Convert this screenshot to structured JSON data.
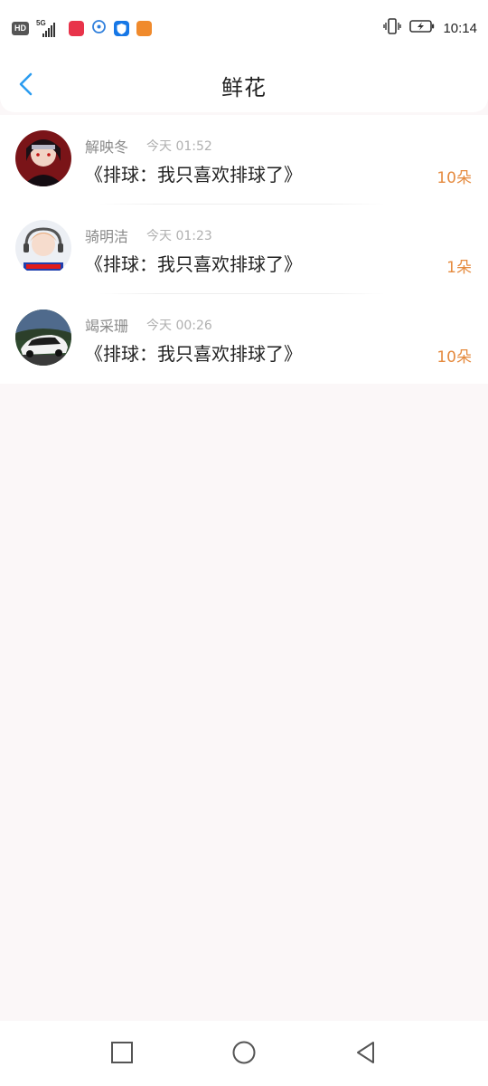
{
  "status_bar": {
    "network": "HD",
    "signal": "5G",
    "time": "10:14",
    "icons": [
      "hd-badge-icon",
      "5g-signal-icon",
      "app-notification-red-icon",
      "app-notification-blue-ring-icon",
      "app-notification-shield-icon",
      "app-notification-orange-icon",
      "vibrate-icon",
      "battery-charging-icon"
    ]
  },
  "header": {
    "title": "鲜花",
    "back_icon": "chevron-left-icon",
    "accent_color": "#2b9cf0"
  },
  "list": {
    "items": [
      {
        "name": "解映冬",
        "time": "今天 01:52",
        "book": "《排球：我只喜欢排球了》",
        "count": "10朵"
      },
      {
        "name": "骑明洁",
        "time": "今天 01:23",
        "book": "《排球：我只喜欢排球了》",
        "count": "1朵"
      },
      {
        "name": "竭采珊",
        "time": "今天 00:26",
        "book": "《排球：我只喜欢排球了》",
        "count": "10朵"
      }
    ],
    "count_color": "#e58a3e"
  },
  "nav_bar": {
    "icons": [
      "recent-apps-square-icon",
      "home-circle-icon",
      "back-triangle-icon"
    ]
  }
}
